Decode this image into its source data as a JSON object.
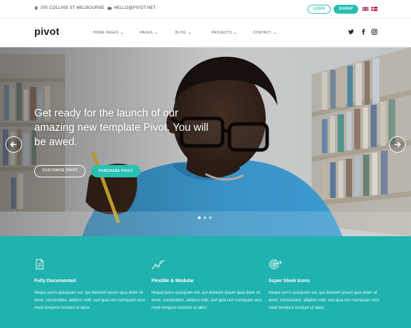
{
  "topbar": {
    "address": "300 COLLINS ST MELBOURNE",
    "email": "HELLO@PIVOT.NET",
    "login_label": "LOGIN",
    "signup_label": "SIGNUP"
  },
  "nav": {
    "logo": "pivot",
    "menu": [
      {
        "label": "HOME PAGES"
      },
      {
        "label": "PAGES"
      },
      {
        "label": "BLOG"
      },
      {
        "label": "PROJECTS"
      },
      {
        "label": "CONTACT"
      }
    ],
    "social_icons": [
      "twitter-icon",
      "facebook-icon",
      "instagram-icon"
    ]
  },
  "hero": {
    "title": "Get ready for the launch of our amazing new template Pivot. You will be awed.",
    "customize_label": "CUSTOMIZE PIVOT",
    "purchase_label": "PURCHASE PIVOT",
    "slides_count": 3,
    "active_slide": 1
  },
  "features": [
    {
      "icon": "document-icon",
      "title": "Fully Documented",
      "body": "Neque porro quisquam est, qui dolorem ipsum quia dolor sit amet, consectetur, adipisci velit, sed quia non numquam eius modi tempora incidunt ut labor."
    },
    {
      "icon": "line-graph-icon",
      "title": "Flexible & Modular",
      "body": "Neque porro quisquam est, qui dolorem ipsum quia dolor sit amet, consectetur, adipisci velit, sed quia non numquam eius modi tempora incidunt ut labor."
    },
    {
      "icon": "target-icon",
      "title": "Super Sleek Icons",
      "body": "Neque porro quisquam est, qui dolorem ipsum quia dolor sit amet, consectetur, adipisci velit, sed quia non numquam eius modi tempora incidunt ut labor."
    }
  ],
  "colors": {
    "accent": "#27c0b3",
    "features_bg": "#1fb2ae"
  }
}
